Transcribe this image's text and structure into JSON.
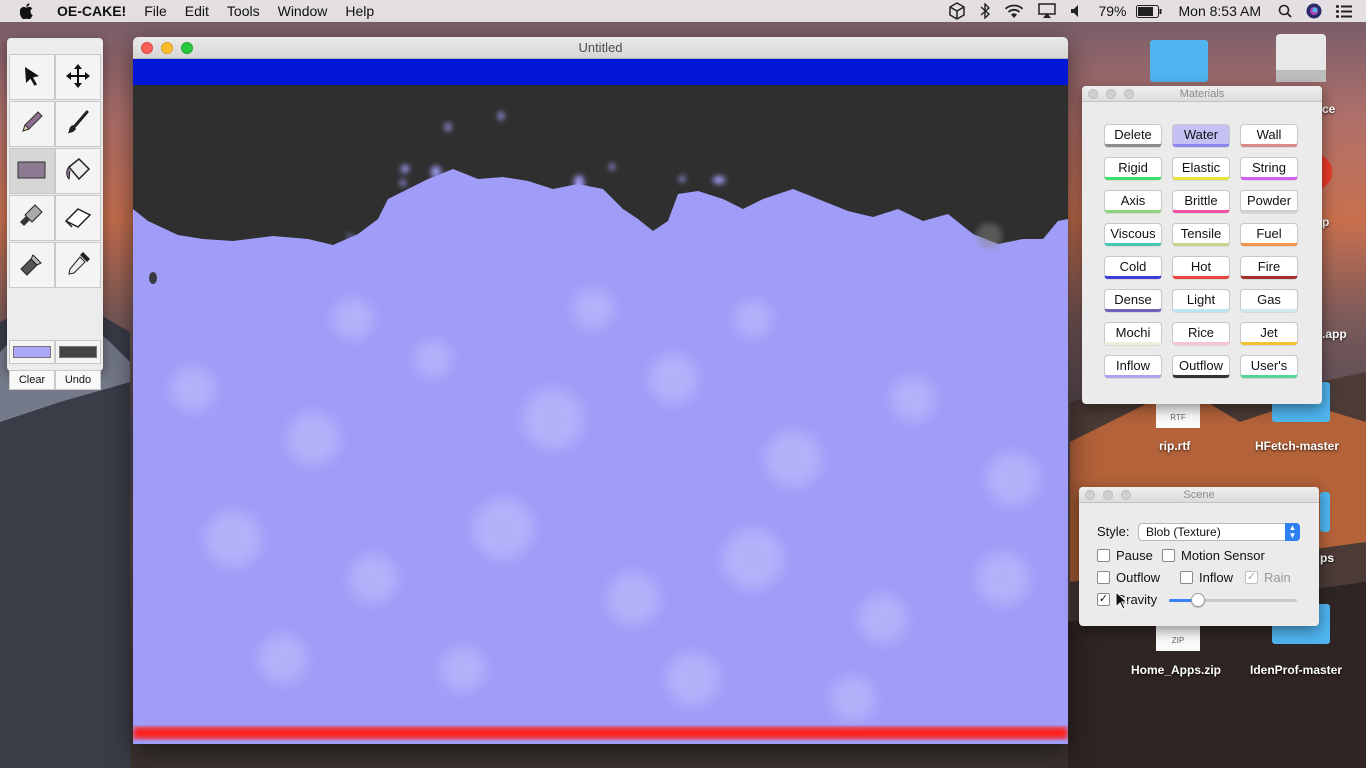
{
  "menubar": {
    "app_name": "OE-CAKE!",
    "menus": [
      "File",
      "Edit",
      "Tools",
      "Window",
      "Help"
    ],
    "battery": "79%",
    "clock": "Mon 8:53 AM"
  },
  "tools": {
    "buttons": [
      "select",
      "move",
      "pencil",
      "brush",
      "rectangle",
      "fill-bucket",
      "knife",
      "eraser",
      "flashlight",
      "dropper"
    ],
    "selected": "rectangle",
    "swatch_primary": "#a9a7f6",
    "swatch_secondary": "#444444",
    "clear_label": "Clear",
    "undo_label": "Undo"
  },
  "main_window": {
    "title": "Untitled",
    "top_bar_color": "#0217d6",
    "bottom_bar_color": "#ff1a14",
    "background_color": "#2f2f2f",
    "water_color": "#a09df8"
  },
  "materials": {
    "title": "Materials",
    "items": [
      {
        "label": "Delete",
        "color": "#8c8c8c"
      },
      {
        "label": "Water",
        "color": "#8b86ef",
        "selected": true
      },
      {
        "label": "Wall",
        "color": "#d98a8a"
      },
      {
        "label": "Rigid",
        "color": "#3ddf6a"
      },
      {
        "label": "Elastic",
        "color": "#e8e43c"
      },
      {
        "label": "String",
        "color": "#d35cf2"
      },
      {
        "label": "Axis",
        "color": "#8ed47e"
      },
      {
        "label": "Brittle",
        "color": "#ef4fa0"
      },
      {
        "label": "Powder",
        "color": "#cfcfcf"
      },
      {
        "label": "Viscous",
        "color": "#45c7b4"
      },
      {
        "label": "Tensile",
        "color": "#c9d489"
      },
      {
        "label": "Fuel",
        "color": "#f2944a"
      },
      {
        "label": "Cold",
        "color": "#3c3cd8"
      },
      {
        "label": "Hot",
        "color": "#e8453f"
      },
      {
        "label": "Fire",
        "color": "#a3302c"
      },
      {
        "label": "Dense",
        "color": "#6b64b8"
      },
      {
        "label": "Light",
        "color": "#bde6f5"
      },
      {
        "label": "Gas",
        "color": "#cfe8ef"
      },
      {
        "label": "Mochi",
        "color": "#f1eedc"
      },
      {
        "label": "Rice",
        "color": "#f5c6d0"
      },
      {
        "label": "Jet",
        "color": "#f2c230"
      },
      {
        "label": "Inflow",
        "color": "#a8a4ee"
      },
      {
        "label": "Outflow",
        "color": "#333333"
      },
      {
        "label": "User's",
        "color": "#55d49a"
      }
    ]
  },
  "scene": {
    "title": "Scene",
    "style_label": "Style:",
    "style_value": "Blob (Texture)",
    "pause_label": "Pause",
    "pause_checked": false,
    "motion_label": "Motion Sensor",
    "motion_checked": false,
    "outflow_label": "Outflow",
    "outflow_checked": false,
    "inflow_label": "Inflow",
    "inflow_checked": false,
    "rain_label": "Rain",
    "rain_checked": true,
    "gravity_label": "Gravity",
    "gravity_checked": true,
    "gravity_level": 0.19
  },
  "desktop": {
    "items": [
      {
        "label": "ce"
      },
      {
        "label": "p"
      },
      {
        "label": ".app"
      },
      {
        "label": "rip.rtf",
        "badge": "RTF"
      },
      {
        "label": "HFetch-master"
      },
      {
        "label": "ps"
      },
      {
        "label": "Home_Apps.zip",
        "badge": "ZIP"
      },
      {
        "label": "IdenProf-master"
      }
    ]
  }
}
